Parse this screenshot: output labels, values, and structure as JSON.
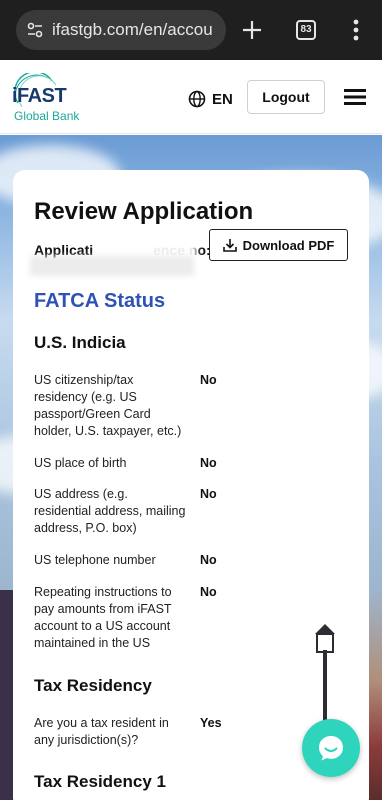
{
  "browser": {
    "url": "ifastgb.com/en/accou",
    "tab_count": "83",
    "icons": [
      "site-settings-icon",
      "plus-icon",
      "tab-switcher-icon",
      "more-vert-icon"
    ]
  },
  "header": {
    "logo_main": "iFAST",
    "logo_sub": "Global Bank",
    "language": "EN",
    "logout_label": "Logout",
    "icons": [
      "globe-icon",
      "hamburger-menu-icon"
    ]
  },
  "page": {
    "title": "Review Application",
    "app_ref_prefix": "Applicati",
    "app_ref_suffix": "ence no:",
    "download_label": "Download PDF",
    "section_title": "FATCA Status",
    "us_indicia_title": "U.S. Indicia",
    "us_indicia": [
      {
        "question": "US citizenship/tax residency (e.g. US passport/Green Card holder, U.S. taxpayer, etc.)",
        "answer": "No"
      },
      {
        "question": "US place of birth",
        "answer": "No"
      },
      {
        "question": "US address (e.g. residential address, mailing address, P.O. box)",
        "answer": "No"
      },
      {
        "question": "US telephone number",
        "answer": "No"
      },
      {
        "question": "Repeating instructions to pay amounts from iFAST account to a US account maintained in the US",
        "answer": "No"
      }
    ],
    "tax_residency_title": "Tax Residency",
    "tax_residency": [
      {
        "question": "Are you a tax resident in any jurisdiction(s)?",
        "answer": "Yes"
      }
    ],
    "tax_residency_1_title": "Tax Residency 1"
  },
  "colors": {
    "accent_blue": "#2f53b5",
    "brand_teal": "#1aa89a",
    "chat_teal": "#2fd4bd"
  }
}
